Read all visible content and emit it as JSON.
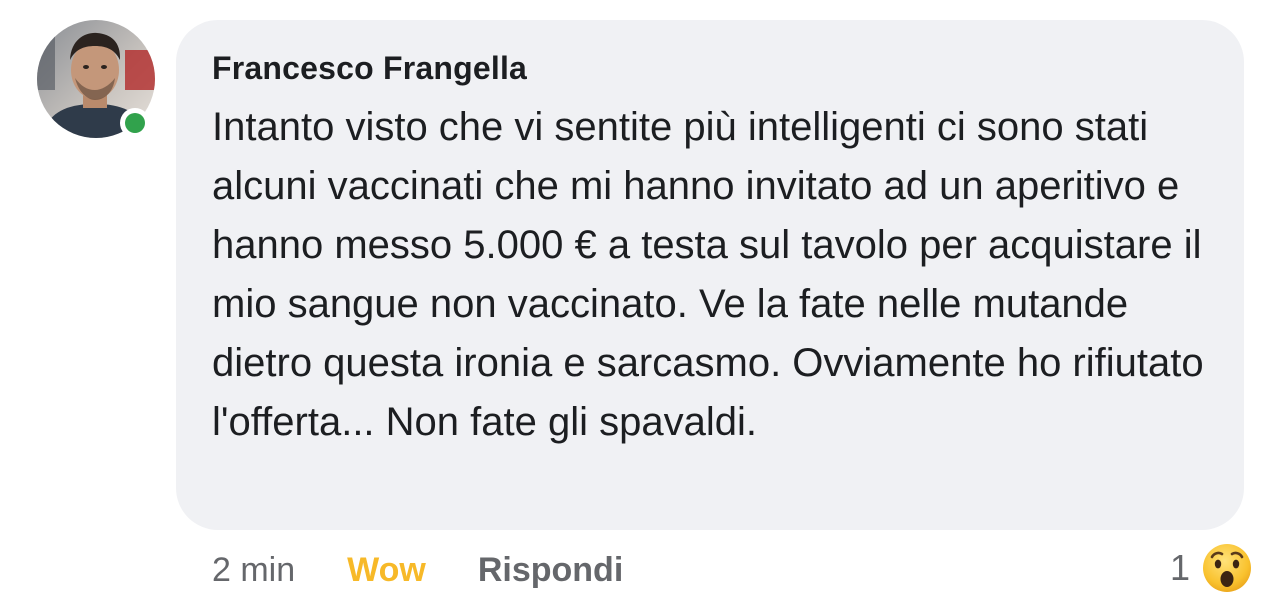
{
  "comment": {
    "author": "Francesco Frangella",
    "text": "Intanto visto che vi sentite più intelligenti ci sono stati alcuni vaccinati che mi hanno invitato ad un aperitivo e hanno messo 5.000 € a testa sul tavolo per acquistare il mio sangue non vaccinato. Ve la fate nelle mutande dietro questa ironia e sarcasmo. Ovviamente ho rifiutato l'offerta... Non fate gli spavaldi.",
    "online": true
  },
  "actions": {
    "time": "2 min",
    "reaction_label": "Wow",
    "reply_label": "Rispondi"
  },
  "reactions": {
    "count": "1",
    "icon": "wow-emoji-icon"
  },
  "colors": {
    "bubble": "#f0f1f4",
    "online": "#31a24c",
    "wow": "#f7b928",
    "secondary_text": "#65676b"
  }
}
